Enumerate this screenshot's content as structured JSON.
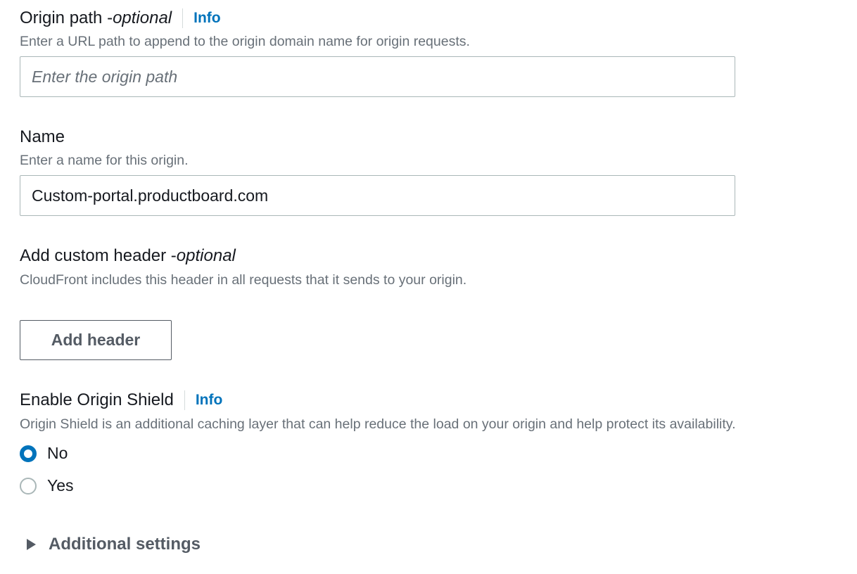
{
  "origin_path": {
    "label": "Origin path - ",
    "optional": "optional",
    "info": "Info",
    "description": "Enter a URL path to append to the origin domain name for origin requests.",
    "placeholder": "Enter the origin path",
    "value": ""
  },
  "name": {
    "label": "Name",
    "description": "Enter a name for this origin.",
    "value": "Custom-portal.productboard.com"
  },
  "custom_header": {
    "label": "Add custom header - ",
    "optional": "optional",
    "description": "CloudFront includes this header in all requests that it sends to your origin.",
    "button_label": "Add header"
  },
  "origin_shield": {
    "label": "Enable Origin Shield",
    "info": "Info",
    "description": "Origin Shield is an additional caching layer that can help reduce the load on your origin and help protect its availability.",
    "options": [
      {
        "label": "No",
        "selected": true
      },
      {
        "label": "Yes",
        "selected": false
      }
    ]
  },
  "additional_settings": {
    "label": "Additional settings"
  },
  "colors": {
    "link": "#0073bb",
    "text": "#16191f",
    "muted": "#687078",
    "border": "#aab7b8",
    "button": "#545b64"
  }
}
